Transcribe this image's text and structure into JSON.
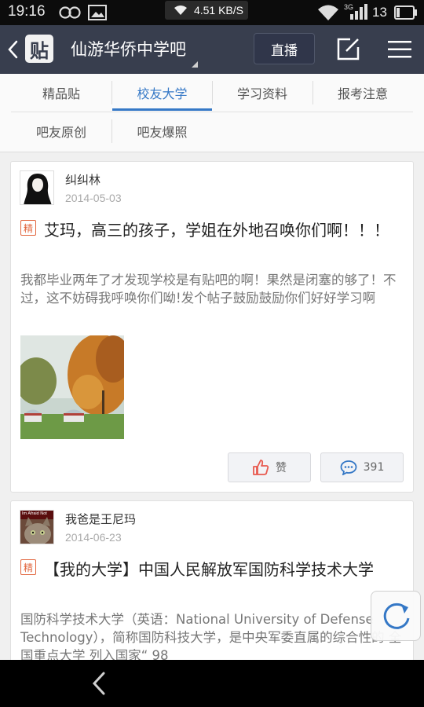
{
  "status_bar": {
    "time": "19:16",
    "net_speed": "4.51 KB/S",
    "signal_type": "3G",
    "battery": "13",
    "icons": [
      "infinity-icon",
      "image-icon",
      "wifi-icon",
      "signal-icon",
      "battery-icon"
    ]
  },
  "header": {
    "logo_char": "贴",
    "title": "仙游华侨中学吧",
    "live_label": "直播",
    "icons": [
      "back-icon",
      "edit-icon",
      "menu-icon"
    ]
  },
  "tabs": [
    {
      "label": "精品贴",
      "active": false
    },
    {
      "label": "校友大学",
      "active": true
    },
    {
      "label": "学习资料",
      "active": false
    },
    {
      "label": "报考注意",
      "active": false
    },
    {
      "label": "吧友原创",
      "active": false
    },
    {
      "label": "吧友爆照",
      "active": false
    }
  ],
  "posts": [
    {
      "author": "纠纠林",
      "date": "2014-05-03",
      "badge": "精",
      "title": "艾玛，高三的孩子，学姐在外地召唤你们啊！！！",
      "body": "我都毕业两年了才发现学校是有贴吧的啊！果然是闭塞的够了！不过，这不妨碍我呼唤你们呦!发个帖子鼓励鼓励你们好好学习啊",
      "like_label": "赞",
      "comment_count": "391"
    },
    {
      "author": "我爸是王尼玛",
      "avatar_text": "Im Afraid Not",
      "date": "2014-06-23",
      "badge": "精",
      "title": "【我的大学】中国人民解放军国防科学技术大学",
      "body": "国防科学技术大学（英语：National University of Defense Technology），简称国防科技大学，是中央军委直属的综合性的 全国重点大学 列入国家“ 98"
    }
  ],
  "colors": {
    "header_bg": "#383e4e",
    "accent": "#3578c6",
    "badge": "#e1643c",
    "like_icon": "#e85a4f"
  }
}
